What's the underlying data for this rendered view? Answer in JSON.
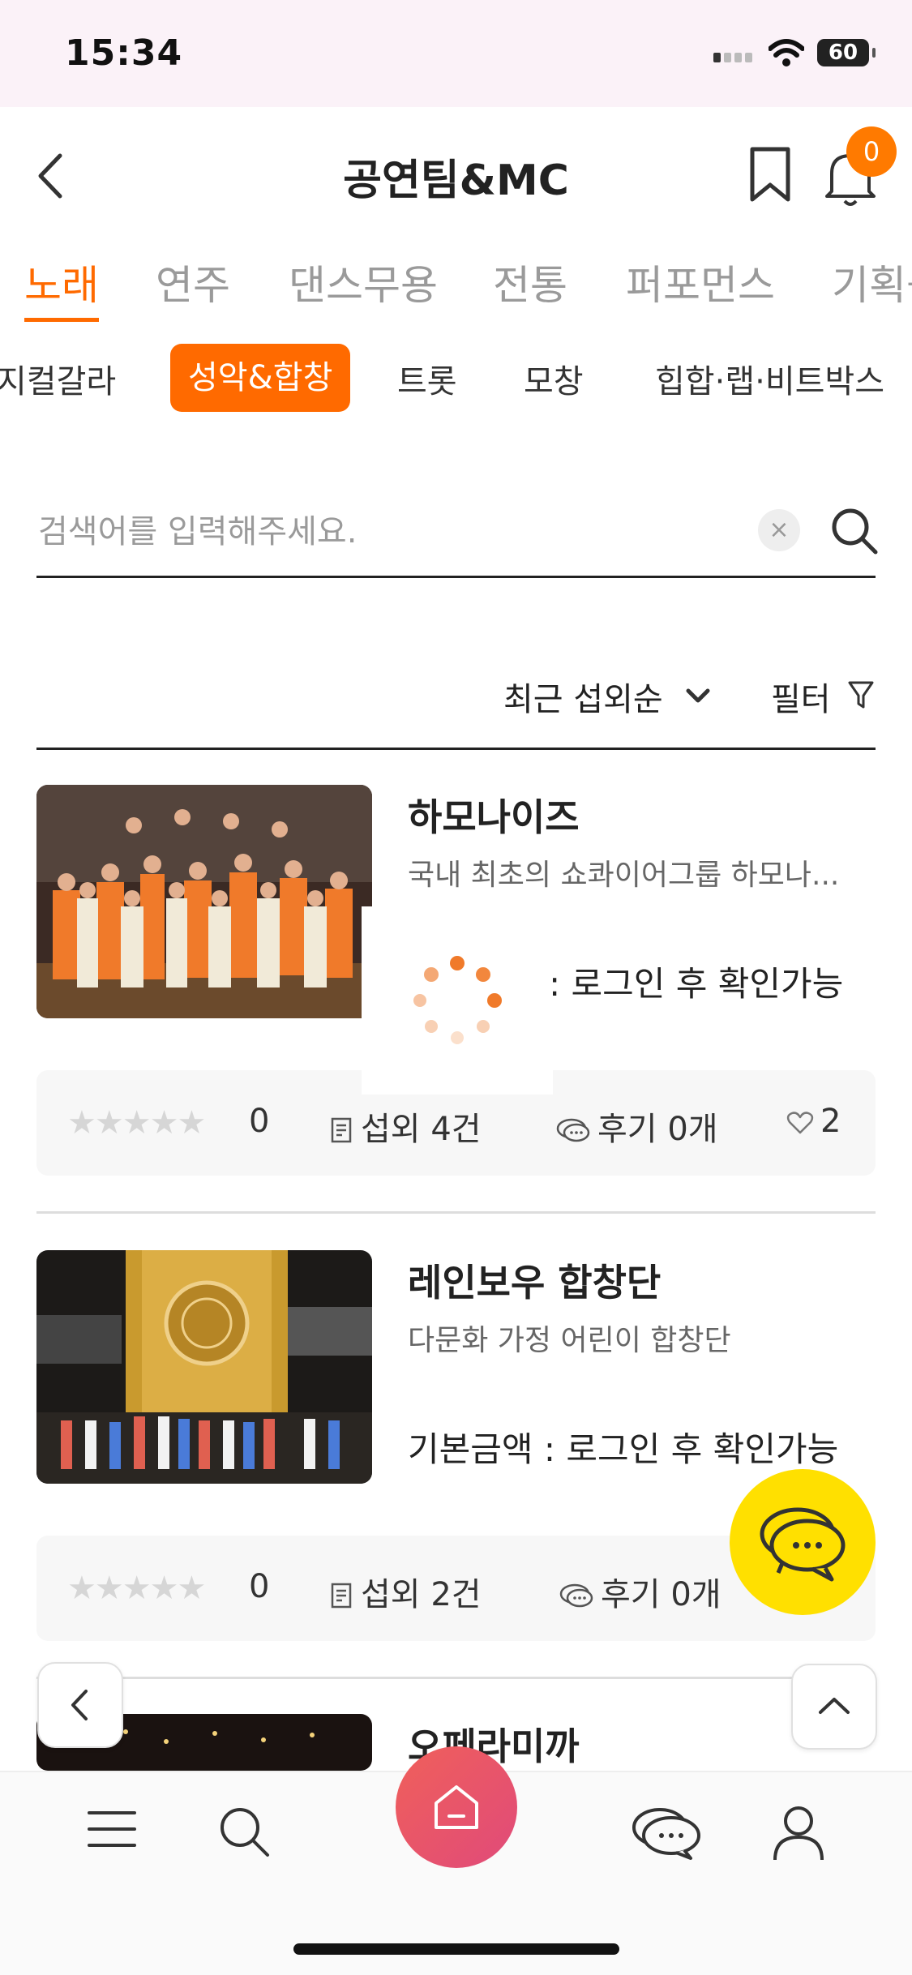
{
  "status_bar": {
    "time": "15:34",
    "battery": "60"
  },
  "header": {
    "title": "공연팀&MC",
    "notification_count": "0"
  },
  "category_tabs": [
    "노래",
    "연주",
    "댄스무용",
    "전통",
    "퍼포먼스",
    "기획공"
  ],
  "sub_tabs": [
    "지컬갈라",
    "성악&합창",
    "트롯",
    "모창",
    "힙합·랩·비트박스"
  ],
  "search": {
    "placeholder": "검색어를 입력해주세요.",
    "clear_label": "×"
  },
  "sort": {
    "label": "최근 섭외순",
    "filter_label": "필터"
  },
  "listings": [
    {
      "title": "하모나이즈",
      "description": "국내 최초의 쇼콰이어그룹 하모나...",
      "price": ": 로그인 후 확인가능",
      "stars": "★★★★★",
      "rating": "0",
      "bookings": "섭외 4건",
      "reviews": "후기 0개",
      "likes": "2"
    },
    {
      "title": "레인보우 합창단",
      "description": "다문화 가정 어린이 합창단",
      "price": "기본금액 : 로그인 후 확인가능",
      "stars": "★★★★★",
      "rating": "0",
      "bookings": "섭외 2건",
      "reviews": "후기 0개",
      "likes": ""
    },
    {
      "title": "오페라미까"
    }
  ],
  "colors": {
    "accent": "#ff6a00",
    "chat_fab": "#ffe000",
    "home_gradient": [
      "#f0605a",
      "#e04a7a"
    ]
  },
  "icons": [
    "back-icon",
    "bookmark-icon",
    "bell-icon",
    "search-icon",
    "chevron-down-icon",
    "filter-icon",
    "document-icon",
    "chat-bubble-icon",
    "heart-icon",
    "menu-icon",
    "home-icon",
    "user-icon",
    "chevron-left-icon",
    "chevron-up-icon"
  ]
}
